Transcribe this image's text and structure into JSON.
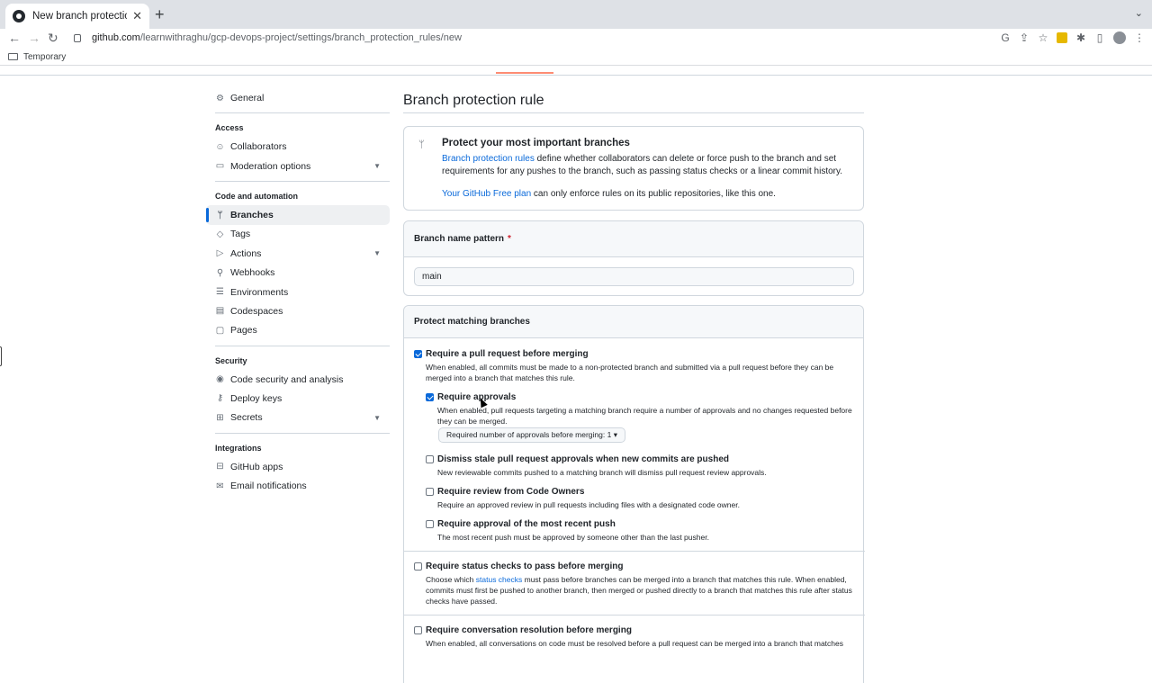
{
  "browser": {
    "tab_title": "New branch protection rule",
    "url_host": "github.com",
    "url_path": "/learnwithraghu/gcp-devops-project/settings/branch_protection_rules/new",
    "bookmark": "Temporary"
  },
  "sidebar": {
    "general": "General",
    "access_head": "Access",
    "collaborators": "Collaborators",
    "moderation": "Moderation options",
    "code_head": "Code and automation",
    "branches": "Branches",
    "tags": "Tags",
    "actions": "Actions",
    "webhooks": "Webhooks",
    "environments": "Environments",
    "codespaces": "Codespaces",
    "pages": "Pages",
    "security_head": "Security",
    "code_security": "Code security and analysis",
    "deploy_keys": "Deploy keys",
    "secrets": "Secrets",
    "integrations_head": "Integrations",
    "github_apps": "GitHub apps",
    "email_notifications": "Email notifications"
  },
  "main": {
    "title": "Branch protection rule",
    "info_title": "Protect your most important branches",
    "info_link": "Branch protection rules",
    "info_text": " define whether collaborators can delete or force push to the branch and set requirements for any pushes to the branch, such as passing status checks or a linear commit history.",
    "plan_link": "Your GitHub Free plan",
    "plan_text": " can only enforce rules on its public repositories, like this one.",
    "pattern_label": "Branch name pattern",
    "required_mark": "*",
    "pattern_value": "main",
    "protect_head": "Protect matching branches",
    "rules": {
      "pr_title": "Require a pull request before merging",
      "pr_desc": "When enabled, all commits must be made to a non-protected branch and submitted via a pull request before they can be merged into a branch that matches this rule.",
      "approvals_title": "Require approvals",
      "approvals_desc": "When enabled, pull requests targeting a matching branch require a number of approvals and no changes requested before they can be merged.",
      "approvals_dropdown": "Required number of approvals before merging: 1 ▾",
      "stale_title": "Dismiss stale pull request approvals when new commits are pushed",
      "stale_desc": "New reviewable commits pushed to a matching branch will dismiss pull request review approvals.",
      "owners_title": "Require review from Code Owners",
      "owners_desc": "Require an approved review in pull requests including files with a designated code owner.",
      "recent_title": "Require approval of the most recent push",
      "recent_desc": "The most recent push must be approved by someone other than the last pusher.",
      "status_title": "Require status checks to pass before merging",
      "status_desc_a": "Choose which ",
      "status_link": "status checks",
      "status_desc_b": " must pass before branches can be merged into a branch that matches this rule. When enabled, commits must first be pushed to another branch, then merged or pushed directly to a branch that matches this rule after status checks have passed.",
      "conv_title": "Require conversation resolution before merging",
      "conv_desc": "When enabled, all conversations on code must be resolved before a pull request can be merged into a branch that matches"
    }
  }
}
